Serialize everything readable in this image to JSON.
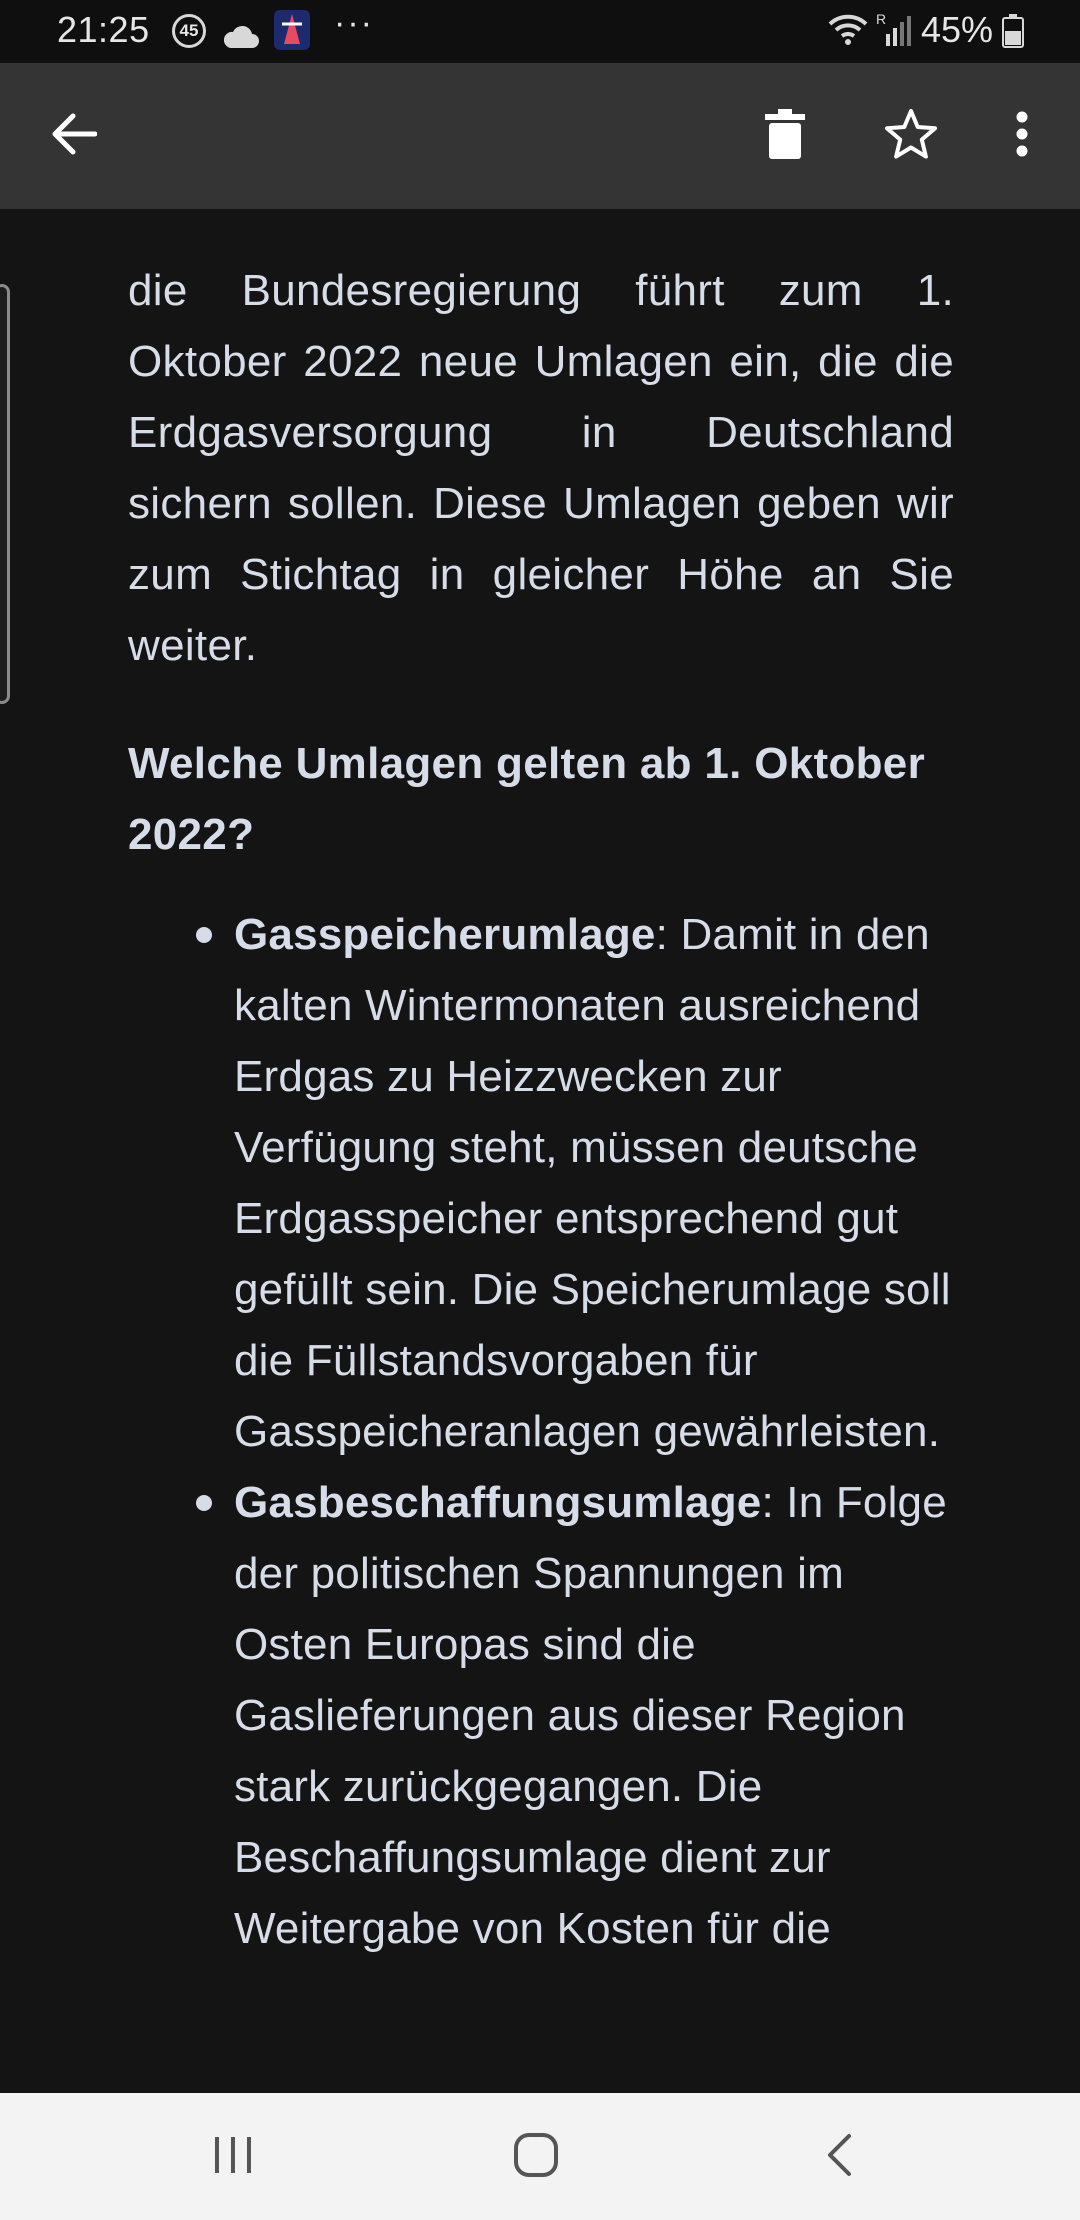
{
  "status_bar": {
    "time": "21:25",
    "notification_count": "45",
    "more": "···",
    "signal_label": "R",
    "battery": "45%"
  },
  "app_bar": {
    "back_icon": "arrow-left-icon",
    "delete_icon": "trash-icon",
    "star_icon": "star-outline-icon",
    "more_icon": "more-vertical-icon"
  },
  "message": {
    "intro_paragraph": "die Bundesregierung führt zum 1. Oktober 2022 neue Umlagen ein, die die Erdgasversorgung in Deutschland sichern sollen. Diese Umlagen geben wir zum Stichtag in gleicher Höhe an Sie weiter.",
    "heading": "Welche Umlagen gelten ab 1. Oktober 2022?",
    "items": [
      {
        "term": "Gasspeicherumlage",
        "text": ": Damit in den kalten Wintermonaten ausreichend Erdgas zu Heizzwecken zur Verfügung steht, müssen deutsche Erdgasspeicher entsprechend gut gefüllt sein. Die Speicherumlage soll die Füllstandsvorgaben für Gasspeicheranlagen gewährleisten."
      },
      {
        "term": "Gasbeschaffungsumlage",
        "text": ": In Folge der politischen Spannungen im Osten Europas sind die Gaslieferungen aus dieser Region stark zurückgegangen. Die Beschaffungsumlage dient zur Weitergabe von Kosten für die"
      }
    ]
  },
  "nav_bar": {
    "recents_icon": "recent-apps-icon",
    "home_icon": "home-icon",
    "back_icon": "back-chevron-icon"
  }
}
